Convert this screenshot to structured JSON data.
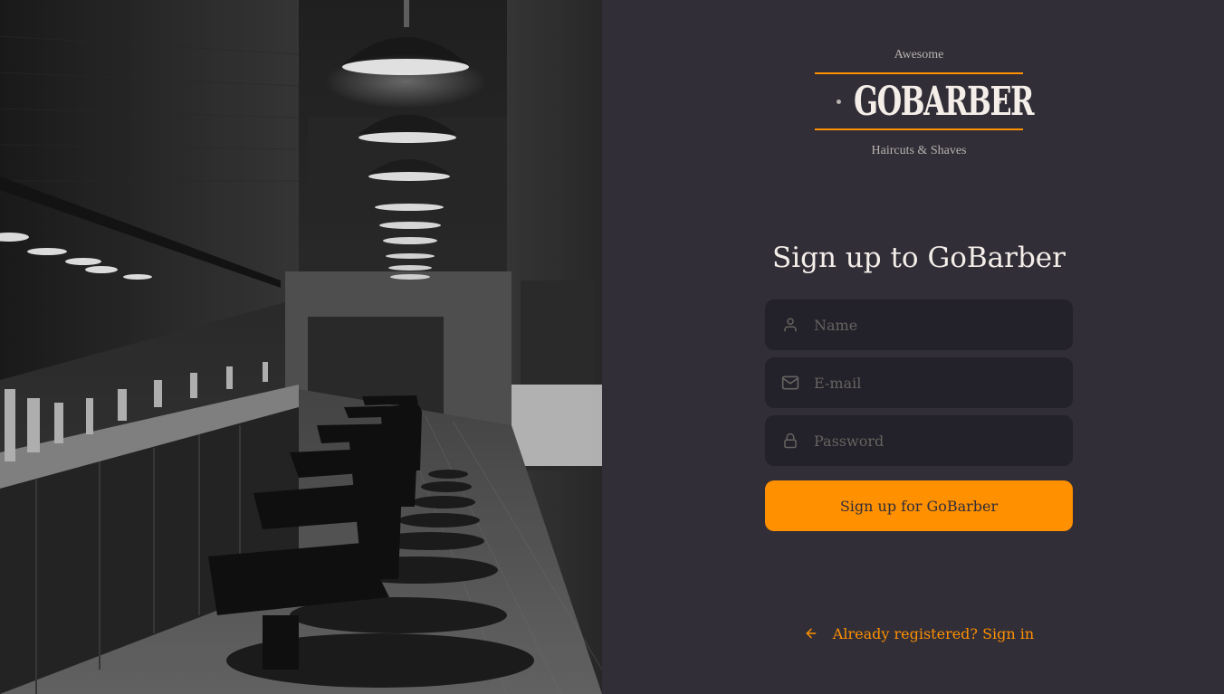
{
  "logo": {
    "top": "Awesome",
    "brand": "GOBARBER",
    "bottom": "Haircuts & Shaves"
  },
  "form": {
    "title": "Sign up to GoBarber",
    "name_placeholder": "Name",
    "email_placeholder": "E-mail",
    "password_placeholder": "Password",
    "submit_label": "Sign up for GoBarber"
  },
  "back_link": {
    "label": "Already registered? Sign in"
  },
  "icons": {
    "name": "user-icon",
    "email": "mail-icon",
    "password": "lock-icon",
    "back": "arrow-left-icon"
  },
  "colors": {
    "background": "#312e38",
    "input_background": "#232129",
    "accent": "#ff9000",
    "text": "#f4ede8",
    "placeholder": "#666360"
  }
}
